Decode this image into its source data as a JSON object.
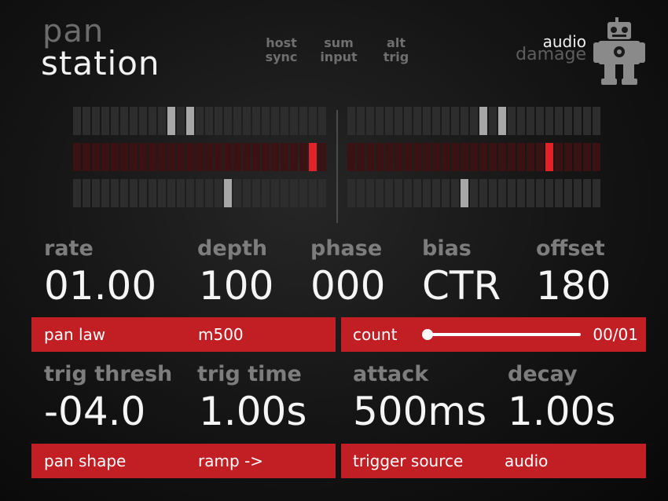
{
  "app": {
    "title_line1": "pan",
    "title_line2": "station",
    "brand_line1": "audio",
    "brand_line2": "damage"
  },
  "modes": [
    {
      "line1": "host",
      "line2": "sync"
    },
    {
      "line1": "sum",
      "line2": "input"
    },
    {
      "line1": "alt",
      "line2": "trig"
    }
  ],
  "meters": {
    "segments_per_row": 27,
    "left_rows": [
      {
        "style": "grey",
        "highlighted": [
          10,
          12
        ]
      },
      {
        "style": "red",
        "highlighted": [
          25
        ]
      },
      {
        "style": "grey",
        "highlighted": [
          16
        ]
      }
    ],
    "right_rows": [
      {
        "style": "grey",
        "highlighted": [
          14,
          16
        ]
      },
      {
        "style": "red",
        "highlighted": [
          21
        ]
      },
      {
        "style": "grey",
        "highlighted": [
          12
        ]
      }
    ]
  },
  "params_top": [
    {
      "label": "rate",
      "value": "01.00"
    },
    {
      "label": "depth",
      "value": "100"
    },
    {
      "label": "phase",
      "value": "000"
    },
    {
      "label": "bias",
      "value": "CTR"
    },
    {
      "label": "offset",
      "value": "180"
    }
  ],
  "bar1": {
    "left_label": "pan law",
    "left_value": "m500",
    "right_label": "count",
    "right_value": "00/01",
    "count_fraction": 0.0
  },
  "params_bottom": [
    {
      "label": "trig thresh",
      "value": "-04.0"
    },
    {
      "label": "trig time",
      "value": "1.00s"
    },
    {
      "label": "attack",
      "value": "500ms"
    },
    {
      "label": "decay",
      "value": "1.00s"
    }
  ],
  "bar2": {
    "left_label": "pan shape",
    "left_value": "ramp ->",
    "right_label": "trigger source",
    "right_value": "audio"
  },
  "colors": {
    "accent_red": "#c21f25",
    "meter_red": "#e32228",
    "label_grey": "#7d7d7d"
  }
}
